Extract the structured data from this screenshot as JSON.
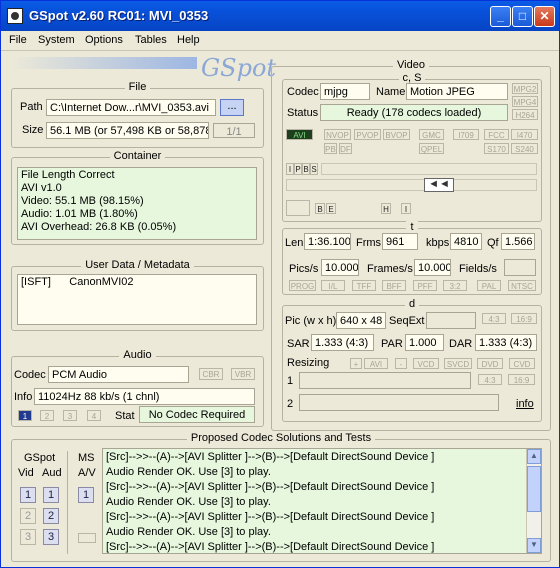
{
  "window": {
    "title": "GSpot v2.60 RC01: MVI_0353"
  },
  "menu": [
    "File",
    "System",
    "Options",
    "Tables",
    "Help"
  ],
  "logo_text": "GSpot",
  "file": {
    "legend": "File",
    "path_label": "Path",
    "path_value": "C:\\Internet Dow...r\\MVI_0353.avi",
    "browse_label": "...",
    "size_label": "Size",
    "size_value": "56.1 MB (or 57,498 KB or 58,878,",
    "part_value": "1/1"
  },
  "container": {
    "legend": "Container",
    "lines": [
      "File Length Correct",
      "AVI v1.0",
      "Video: 55.1 MB (98.15%)",
      "Audio: 1.01 MB (1.80%)",
      "AVI Overhead: 26.8 KB (0.05%)"
    ]
  },
  "metadata": {
    "legend": "User Data / Metadata",
    "lines": [
      "[ISFT]      CanonMVI02"
    ]
  },
  "audio": {
    "legend": "Audio",
    "codec_label": "Codec",
    "codec_value": "PCM Audio",
    "cbr": "CBR",
    "vbr": "VBR",
    "info_label": "Info",
    "info_value": "11024Hz  88 kb/s (1 chnl)",
    "stream_buttons": [
      "1",
      "2",
      "3",
      "4"
    ],
    "stat_label": "Stat",
    "stat_value": "No Codec Required"
  },
  "video": {
    "legend": "Video",
    "cs_legend": "c, S",
    "codec_label": "Codec",
    "codec_value": "mjpg",
    "name_label": "Name",
    "name_value": "Motion JPEG",
    "mpg_buttons": [
      "MPG2",
      "MPG4",
      "H264"
    ],
    "status_label": "Status",
    "status_value": "Ready (178 codecs loaded)",
    "flags_row1": [
      "AVI",
      "NVOP",
      "PVOP",
      "BVOP",
      "GMC",
      "I709",
      "FCC",
      "I470"
    ],
    "flags_row2": [
      "PB",
      "DF",
      "QPEL",
      "S170",
      "S240"
    ],
    "ipbs": [
      "I",
      "P",
      "B",
      "S"
    ],
    "be_buttons": [
      "B",
      "E"
    ],
    "hi_buttons": [
      "H",
      "I"
    ],
    "t_legend": "t",
    "len_label": "Len",
    "len_value": "1:36.100",
    "frms_label": "Frms",
    "frms_value": "961",
    "kbps_label": "kbps",
    "kbps_value": "4810",
    "qf_label": "Qf",
    "qf_value": "1.566",
    "pics_label": "Pics/s",
    "pics_value": "10.000",
    "frames_label": "Frames/s",
    "frames_value": "10.000",
    "fields_label": "Fields/s",
    "pulldown": [
      "PROG",
      "I/L",
      "TFF",
      "BFF",
      "PFF",
      "3:2",
      "PAL",
      "NTSC"
    ],
    "d_legend": "d",
    "pic_label": "Pic (w x h)",
    "pic_value": "640 x 48",
    "seqext_label": "SeqExt",
    "ar_buttons": [
      "4:3",
      "16:9"
    ],
    "sar_label": "SAR",
    "sar_value": "1.333 (4:3)",
    "par_label": "PAR",
    "par_value": "1.000",
    "dar_label": "DAR",
    "dar_value": "1.333 (4:3)",
    "resizing_label": "Resizing",
    "resize_buttons": [
      "+",
      "AVI",
      "-",
      "VCD",
      "SVCD",
      "DVD",
      "CVD"
    ],
    "row1_label": "1",
    "row2_label": "2",
    "ar_buttons2": [
      "4:3",
      "16:9"
    ],
    "info_link": "info"
  },
  "proposed": {
    "legend": "Proposed Codec Solutions and Tests",
    "gspot_label": "GSpot",
    "ms_label": "MS",
    "vid_label": "Vid",
    "aud_label": "Aud",
    "av_label": "A/V",
    "nums": [
      "1",
      "2",
      "3"
    ],
    "lines": [
      "[Src]-->>--(A)-->[AVI Splitter ]-->(B)-->[Default DirectSound Device ]",
      "Audio Render OK. Use [3] to play.",
      "[Src]-->>--(A)-->[AVI Splitter ]-->(B)-->[Default DirectSound Device ]",
      "Audio Render OK. Use [3] to play.",
      "[Src]-->>--(A)-->[AVI Splitter ]-->(B)-->[Default DirectSound Device ]",
      "Audio Render OK. Use [3] to play.",
      "[Src]-->>--(A)-->[AVI Splitter ]-->(B)-->[Default DirectSound Device ]"
    ]
  }
}
